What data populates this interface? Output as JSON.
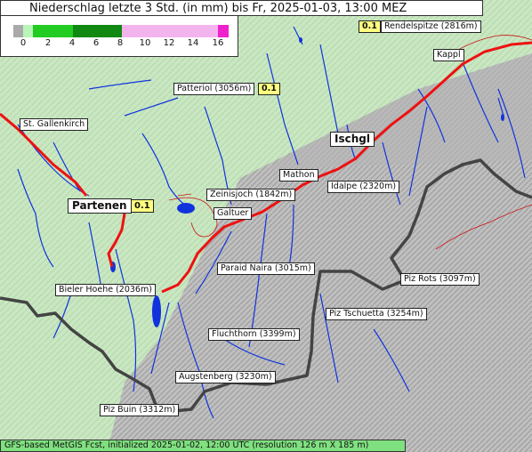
{
  "title": "Niederschlag letzte 3 Std. (in mm) bis Fr, 2025-01-03, 13:00 MEZ",
  "legend": {
    "ticks": [
      "0",
      "2",
      "4",
      "6",
      "8",
      "10",
      "12",
      "14",
      "16"
    ],
    "colors": {
      "zero": "#aaaaaa",
      "light": "#b9f5b9",
      "green": "#22cc22",
      "dark_green": "#118811",
      "pink": "#f3b4ee",
      "magenta": "#ee22cc"
    }
  },
  "labels": {
    "rendelspitze": "Rendelspitze (2816m)",
    "kappl": "Kappl",
    "patteriol": "Patteriol (3056m)",
    "st_gallenkirch": "St. Gallenkirch",
    "ischgl": "Ischgl",
    "mathon": "Mathon",
    "idalpe": "Idalpe (2320m)",
    "zeinisjoch": "Zeinisjoch (1842m)",
    "partenen": "Partenen",
    "galtuer": "Galtuer",
    "paraid_naira": "Paraid Naira (3015m)",
    "piz_rots": "Piz Rots (3097m)",
    "bieler_hoehe": "Bieler Hoehe (2036m)",
    "piz_tschuetta": "Piz Tschuetta (3254m)",
    "fluchthorn": "Fluchthorn (3399m)",
    "augstenberg": "Augstenberg (3230m)",
    "piz_buin": "Piz Buin (3312m)"
  },
  "precip_values": {
    "rendelspitze": "0.1",
    "patteriol": "0.1",
    "partenen": "0.1"
  },
  "footer": "GFS-based MetGIS Fcst, initialized 2025-01-02, 12:00 UTC  (resolution 126 m X 185 m)",
  "map_colors": {
    "valley_green": "#c9e8c2",
    "terrain_grey": "#a8a8a8",
    "river": "#1133dd",
    "lake": "#1133dd",
    "road": "#ee1111",
    "border": "#444444"
  }
}
